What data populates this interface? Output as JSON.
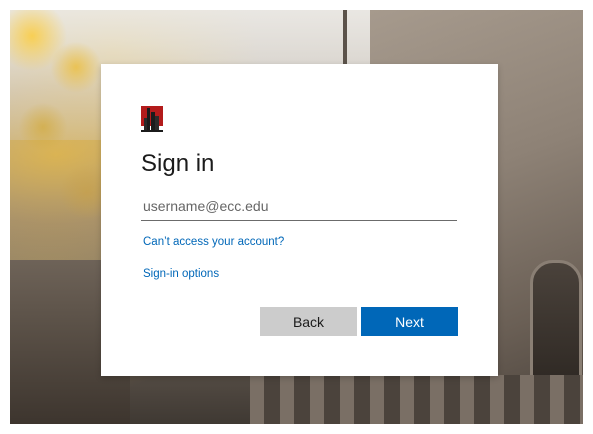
{
  "background": {
    "description_colors": {
      "accent_leaves": "#e8b83c",
      "stone": "#8c8177"
    }
  },
  "signin": {
    "logo_icon": "college-building-logo-icon",
    "title": "Sign in",
    "username_placeholder": "username@ecc.edu",
    "username_value": "",
    "cant_access_link": "Can’t access your account?",
    "signin_options_link": "Sign-in options",
    "back_button": "Back",
    "next_button": "Next",
    "colors": {
      "primary": "#0067b8",
      "secondary_button": "#cccccc",
      "text": "#1b1b1b"
    }
  }
}
